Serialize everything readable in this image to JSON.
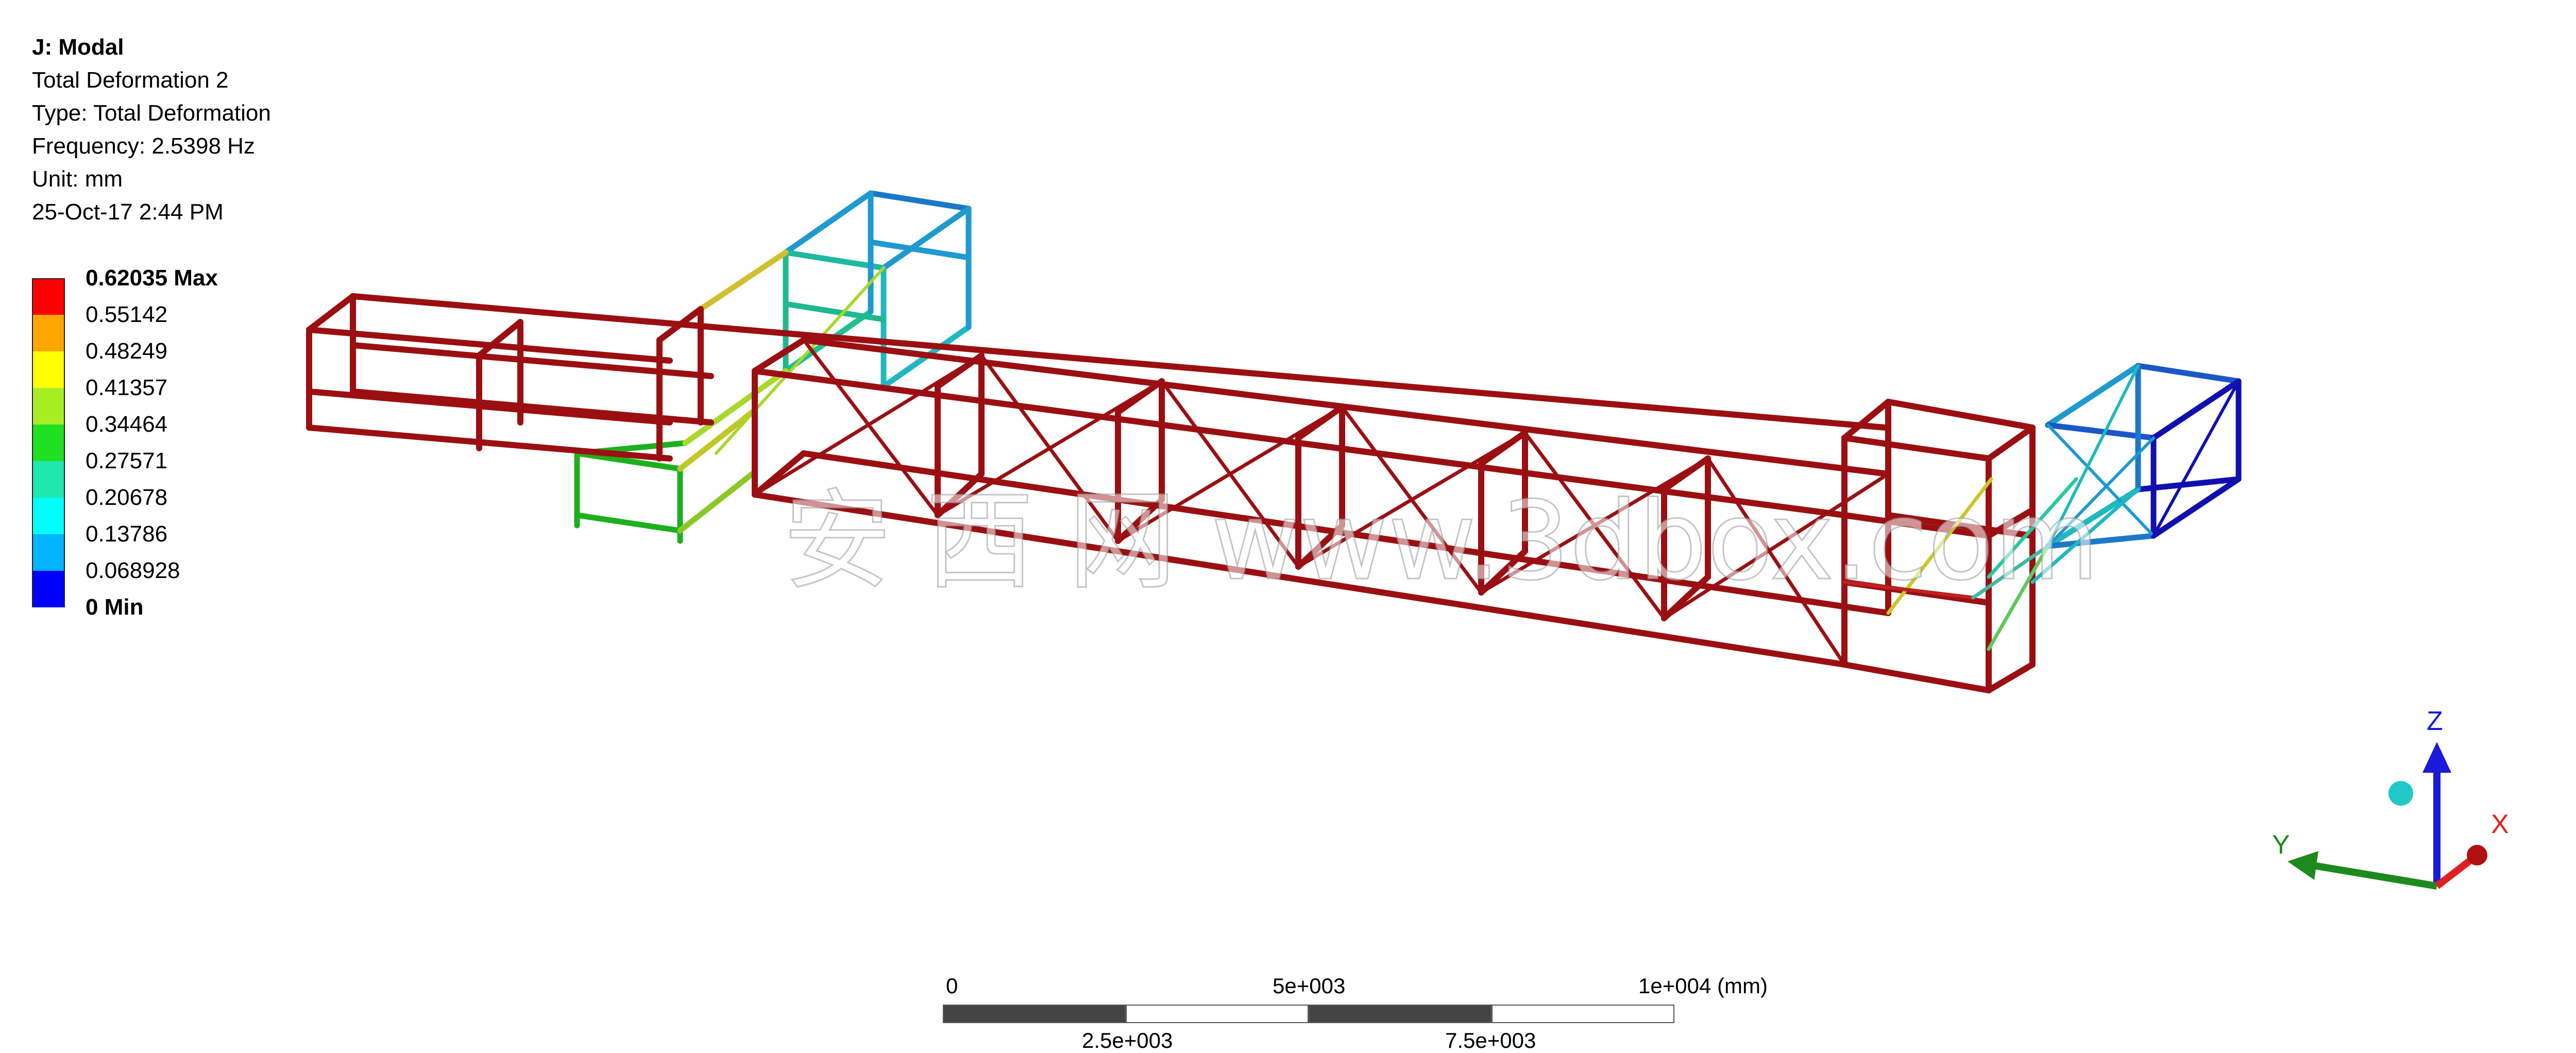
{
  "info": {
    "analysis_name": "J: Modal",
    "result_name": "Total Deformation 2",
    "type_line": "Type: Total Deformation",
    "frequency_line": "Frequency: 2.5398 Hz",
    "unit_line": "Unit: mm",
    "date_line": "25-Oct-17 2:44 PM"
  },
  "legend": {
    "entries": [
      {
        "label": "0.62035 Max",
        "color": "#ff0000",
        "bold": true
      },
      {
        "label": "0.55142",
        "color": "#ffa500",
        "bold": false
      },
      {
        "label": "0.48249",
        "color": "#ffff00",
        "bold": false
      },
      {
        "label": "0.41357",
        "color": "#a6ee23",
        "bold": false
      },
      {
        "label": "0.34464",
        "color": "#21e021",
        "bold": false
      },
      {
        "label": "0.27571",
        "color": "#1ee8b0",
        "bold": false
      },
      {
        "label": "0.20678",
        "color": "#00ffff",
        "bold": false
      },
      {
        "label": "0.13786",
        "color": "#00b4ff",
        "bold": false
      },
      {
        "label": "0.068928",
        "color": "#0000ff",
        "bold": false
      },
      {
        "label": "0 Min",
        "color": null,
        "bold": true
      }
    ]
  },
  "scale_bar": {
    "label_0": "0",
    "label_5000": "5e+003",
    "label_10000": "1e+004 (mm)",
    "label_2500": "2.5e+003",
    "label_7500": "7.5e+003"
  },
  "triad": {
    "x_label": "X",
    "y_label": "Y",
    "z_label": "Z",
    "x_color": "#e02020",
    "y_color": "#1c8a1c",
    "z_color": "#1a1ad8",
    "iso_ball_color": "#20c8c8"
  },
  "watermark": {
    "text": "安 西 网 www.3dbox.com"
  },
  "colors": {
    "max_member": "#9b0f12",
    "dark_base": "#0a0a8a"
  }
}
